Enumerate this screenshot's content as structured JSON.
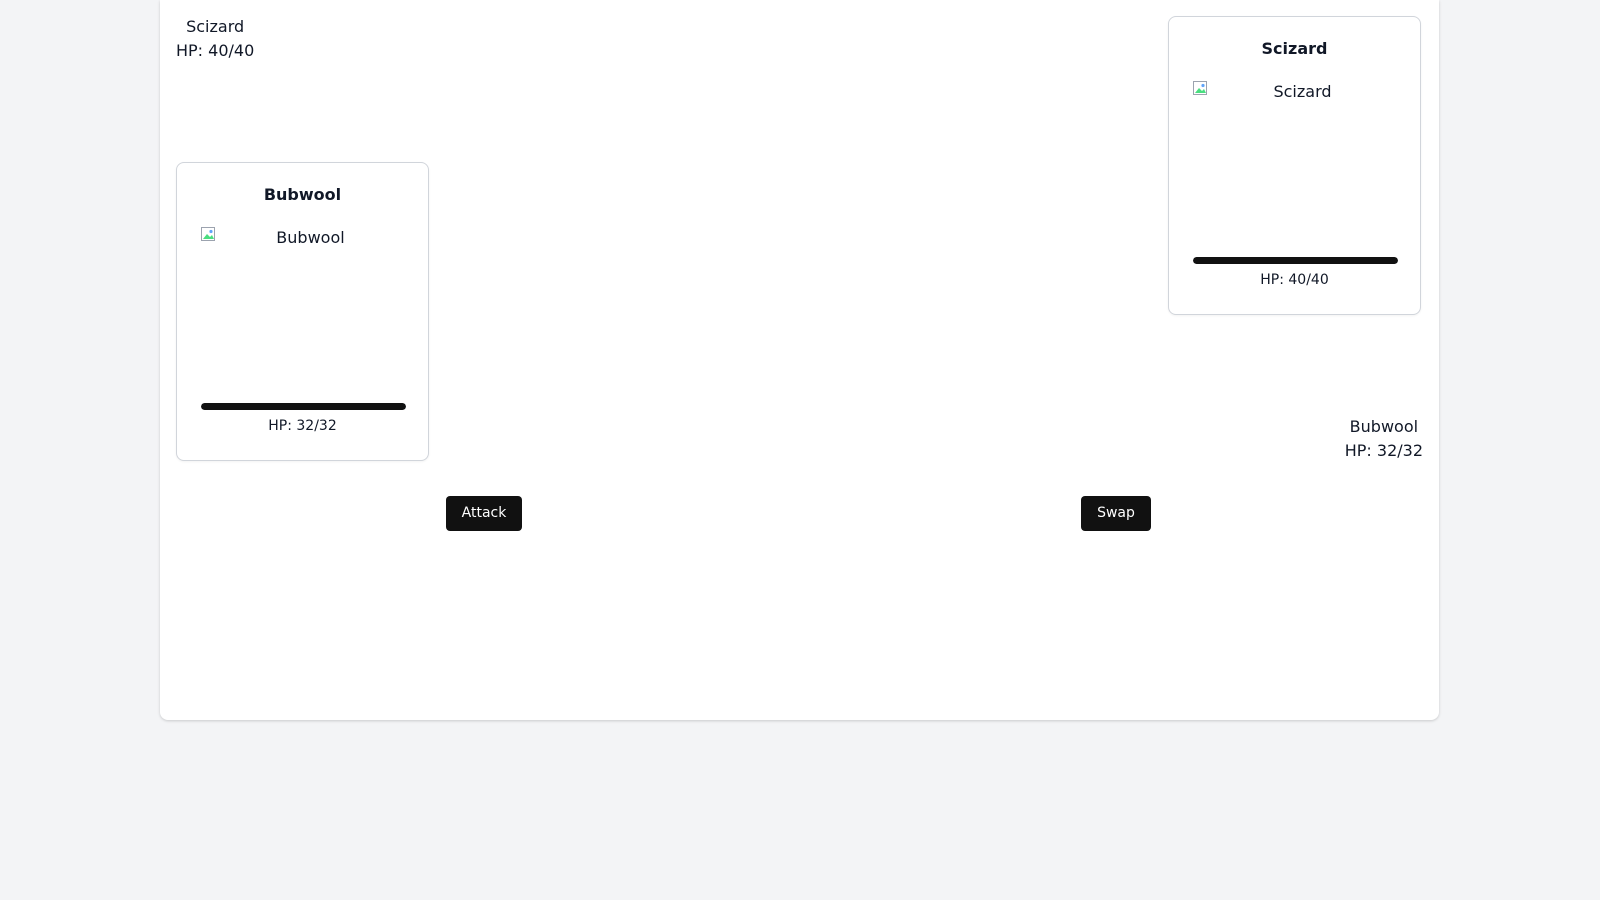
{
  "enemy": {
    "name": "Scizard",
    "hp_label": "HP: 40/40",
    "hp_current": 40,
    "hp_max": 40,
    "hp_fraction": 1.0,
    "sprite_alt": "Scizard"
  },
  "player": {
    "name": "Bubwool",
    "hp_label": "HP: 32/32",
    "hp_current": 32,
    "hp_max": 32,
    "hp_fraction": 1.0,
    "sprite_alt": "Bubwool"
  },
  "actions": {
    "attack_label": "Attack",
    "swap_label": "Swap"
  },
  "icons": {
    "broken_image": "broken-image-icon"
  },
  "colors": {
    "background": "#f3f4f6",
    "panel": "#ffffff",
    "hp_bar": "#111111",
    "button": "#111111",
    "button_text": "#ffffff"
  }
}
